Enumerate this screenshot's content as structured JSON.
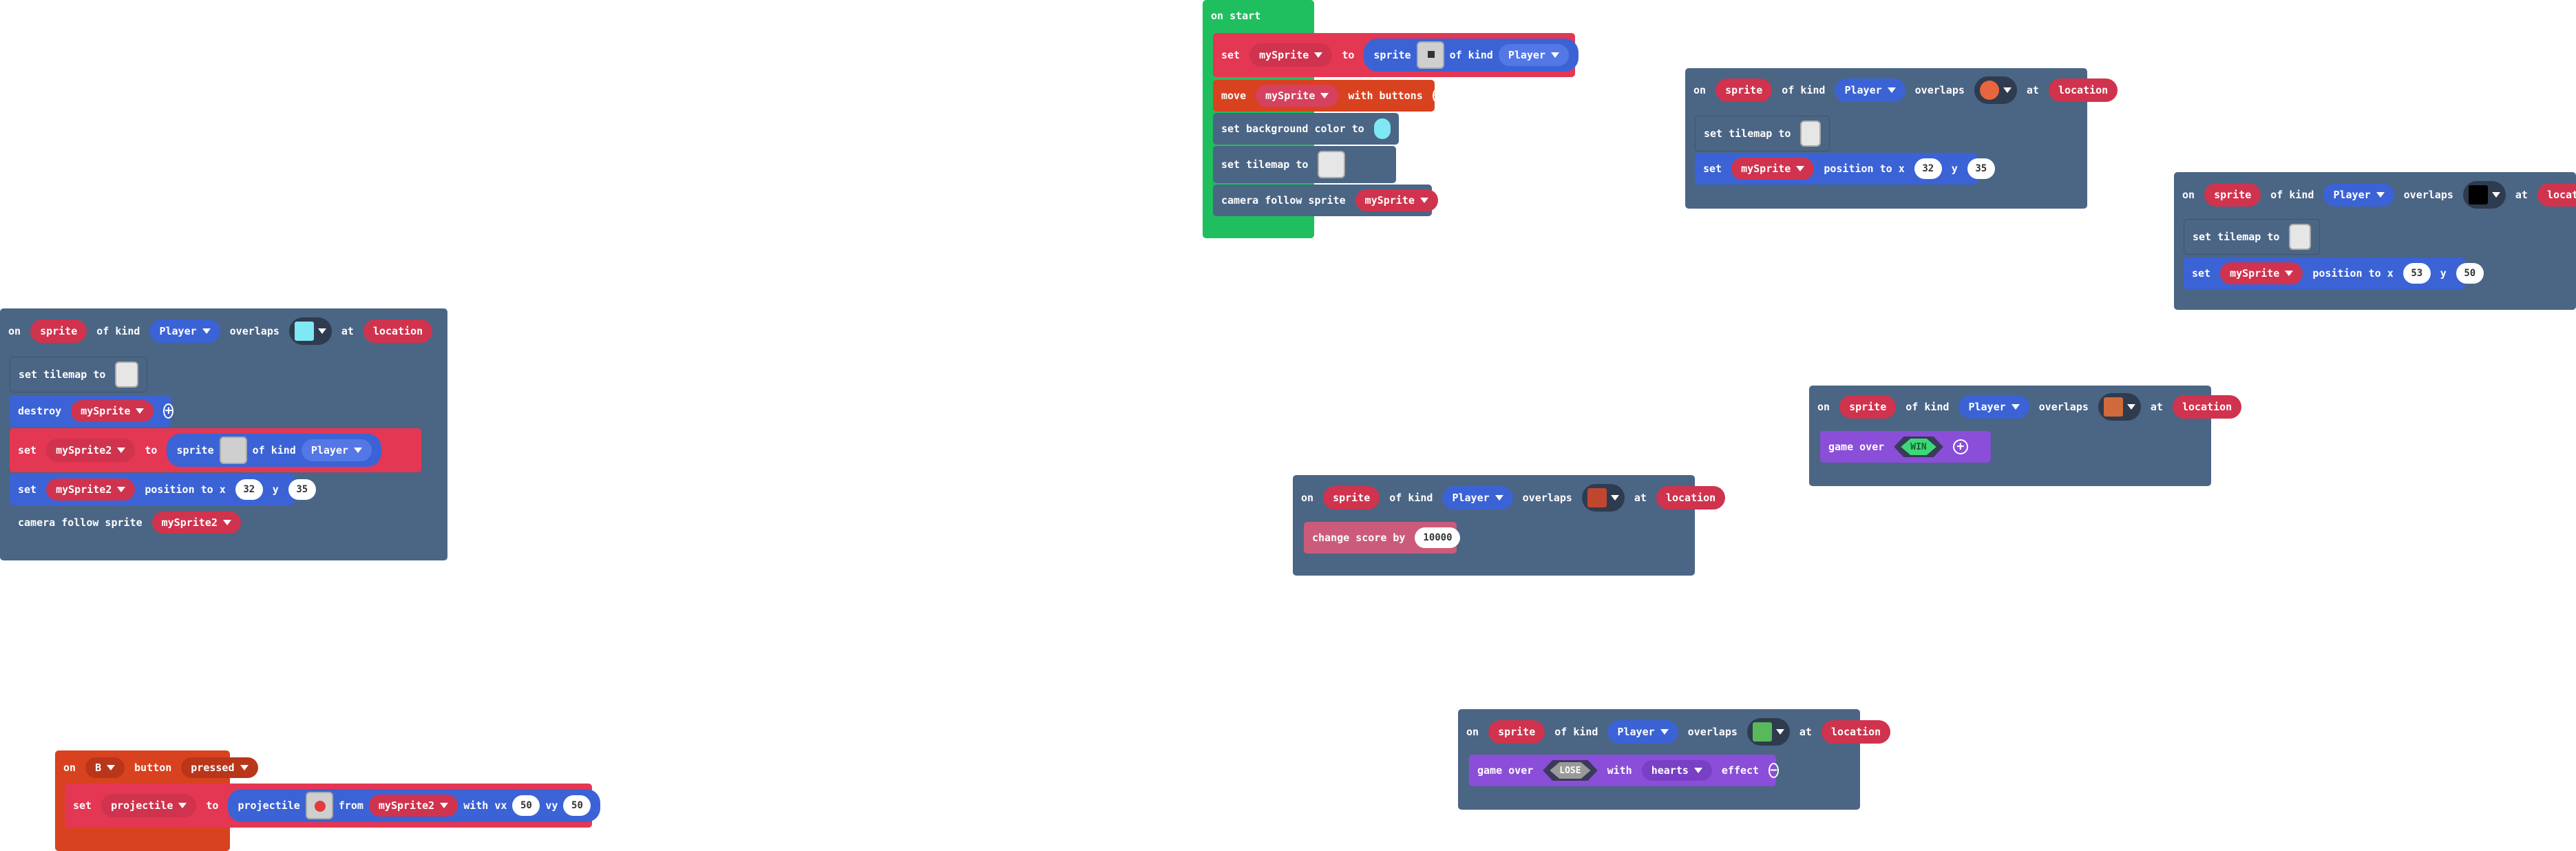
{
  "colors": {
    "loops": "#1fbf5f",
    "event": "#4b6584",
    "set": "#e43753",
    "sprite": "#3b63d6",
    "game": "#8a4ed8",
    "info": "#cc5b7b",
    "controller": "#d9421f"
  },
  "on_start": {
    "title": "on start",
    "set_label": "set",
    "var1": "mySprite",
    "to_label": "to",
    "sprite_label": "sprite",
    "of_kind_label": "of kind",
    "kind": "Player",
    "move_label": "move",
    "move_var": "mySprite",
    "with_buttons_label": "with buttons",
    "bg_label": "set background color to",
    "bg_color": "#7ee8f4",
    "tilemap_label": "set tilemap to",
    "camera_label": "camera follow sprite",
    "camera_var": "mySprite"
  },
  "overlap_common": {
    "on": "on",
    "sprite": "sprite",
    "of_kind": "of kind",
    "kind": "Player",
    "overlaps": "overlaps",
    "at": "at",
    "location": "location"
  },
  "overlap_a": {
    "tilemap_label": "set tilemap to",
    "destroy_label": "destroy",
    "destroy_var": "mySprite",
    "set_label": "set",
    "var2": "mySprite2",
    "to": "to",
    "sprite": "sprite",
    "of_kind": "of kind",
    "kind": "Player",
    "pos_set": "set",
    "pos_var": "mySprite2",
    "pos_label": "position to x",
    "x": "32",
    "y_label": "y",
    "y": "35",
    "camera_label": "camera follow sprite",
    "camera_var": "mySprite2"
  },
  "overlap_b": {
    "tilemap_label": "set tilemap to",
    "pos_set": "set",
    "pos_var": "mySprite",
    "pos_label": "position to x",
    "x": "32",
    "y_label": "y",
    "y": "35"
  },
  "overlap_c": {
    "tilemap_label": "set tilemap to",
    "pos_set": "set",
    "pos_var": "mySprite",
    "pos_label": "position to x",
    "x": "53",
    "y_label": "y",
    "y": "50"
  },
  "overlap_d": {
    "score_label": "change score by",
    "score": "10000"
  },
  "overlap_e": {
    "game_over_label": "game over",
    "result": "WIN"
  },
  "overlap_f": {
    "game_over_label": "game over",
    "result": "LOSE",
    "with": "with",
    "effect_name": "hearts",
    "effect": "effect"
  },
  "button_event": {
    "on": "on",
    "button": "B",
    "button_label": "button",
    "state": "pressed",
    "set": "set",
    "var": "projectile",
    "to": "to",
    "projectile": "projectile",
    "from": "from",
    "from_var": "mySprite2",
    "vx_label": "with vx",
    "vx": "50",
    "vy_label": "vy",
    "vy": "50"
  }
}
